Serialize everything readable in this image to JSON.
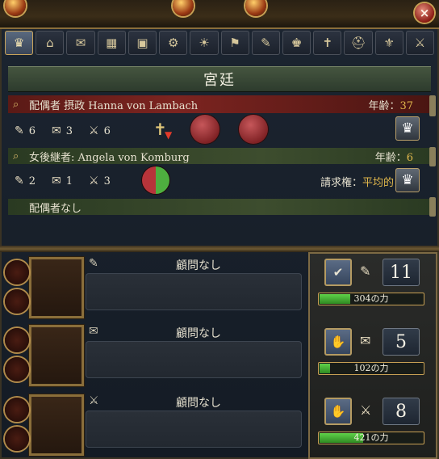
{
  "window": {
    "close_label": "×"
  },
  "tabs": [
    {
      "icon": "crown-icon",
      "glyph": "♛"
    },
    {
      "icon": "temple-icon",
      "glyph": "⌂"
    },
    {
      "icon": "dove-icon",
      "glyph": "✉"
    },
    {
      "icon": "goods-icon",
      "glyph": "▦"
    },
    {
      "icon": "crates-icon",
      "glyph": "▣"
    },
    {
      "icon": "gear-icon",
      "glyph": "⚙"
    },
    {
      "icon": "idea-icon",
      "glyph": "☀"
    },
    {
      "icon": "flag-icon",
      "glyph": "⚑"
    },
    {
      "icon": "scroll-icon",
      "glyph": "✎"
    },
    {
      "icon": "crown-small-icon",
      "glyph": "♚"
    },
    {
      "icon": "cross-icon",
      "glyph": "✝"
    },
    {
      "icon": "helmet-icon",
      "glyph": "⛑"
    },
    {
      "icon": "heraldry-icon",
      "glyph": "⚜"
    },
    {
      "icon": "crossed-swords-icon",
      "glyph": "⚔"
    }
  ],
  "court": {
    "title": "宮廷",
    "consort": {
      "name": "配偶者 摂政 Hanna von Lambach",
      "age_label": "年齢：",
      "age": "37",
      "adm": "6",
      "dip": "3",
      "mil": "6"
    },
    "heir": {
      "name": "女後継者: Angela von Komburg",
      "age_label": "年齢：",
      "age": "6",
      "adm": "2",
      "dip": "1",
      "mil": "3",
      "claim_label": "請求権：",
      "claim_value": "平均的"
    },
    "spouse_none": "配偶者なし"
  },
  "advisors": [
    {
      "type_icon": "scroll-icon",
      "label": "顧問なし"
    },
    {
      "type_icon": "dove-icon",
      "label": "顧問なし"
    },
    {
      "type_icon": "crossed-swords-icon",
      "label": "顧問なし"
    }
  ],
  "monarch_power": [
    {
      "category": "administrative",
      "value": "11",
      "power_label": "304の力",
      "fill_fraction": 0.3
    },
    {
      "category": "diplomatic",
      "value": "5",
      "power_label": "102の力",
      "fill_fraction": 0.1
    },
    {
      "category": "military",
      "value": "8",
      "power_label": "421の力",
      "fill_fraction": 0.42
    }
  ],
  "colors": {
    "age_highlight": "#e2b84c",
    "power_bar": "#4cbb3a"
  }
}
